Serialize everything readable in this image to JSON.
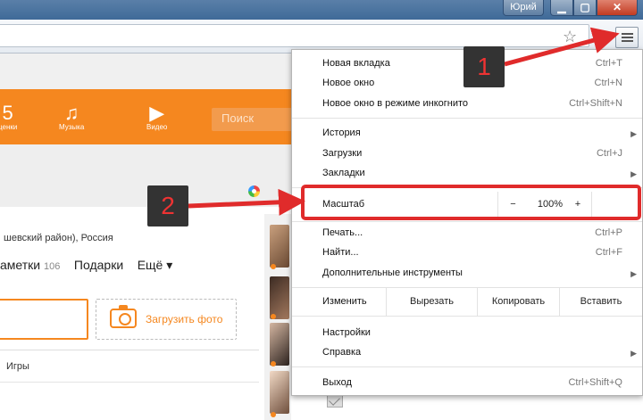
{
  "window": {
    "user_label": "Юрий",
    "minimize_glyph": "▁",
    "maximize_glyph": "▢",
    "close_glyph": "✕"
  },
  "toolbar": {
    "bookmark_icon": "☆",
    "menu_icon": "hamburger-icon"
  },
  "site": {
    "nav": [
      {
        "label": "ценки",
        "icon": "ratings-icon",
        "glyph": "5"
      },
      {
        "label": "Музыка",
        "icon": "music-icon",
        "glyph": "♫"
      },
      {
        "label": "Видео",
        "icon": "video-icon",
        "glyph": "▶"
      }
    ],
    "search_placeholder": "Поиск",
    "location": "шевский район), Россия",
    "profile_nav": {
      "notes_label": "аметки",
      "notes_count": "106",
      "gifts_label": "Подарки",
      "more_label": "Ещё ▾"
    },
    "upload_photo_label": "Загрузить фото",
    "games_label": "Игры",
    "accent_color": "#f5871f"
  },
  "menu": {
    "new_tab": {
      "label": "Новая вкладка",
      "shortcut": "Ctrl+T"
    },
    "new_window": {
      "label": "Новое окно",
      "shortcut": "Ctrl+N"
    },
    "incognito": {
      "label": "Новое окно в режиме инкогнито",
      "shortcut": "Ctrl+Shift+N"
    },
    "history": {
      "label": "История"
    },
    "downloads": {
      "label": "Загрузки",
      "shortcut": "Ctrl+J"
    },
    "bookmarks": {
      "label": "Закладки"
    },
    "zoom": {
      "label": "Масштаб",
      "minus": "−",
      "value": "100%",
      "plus": "+"
    },
    "print": {
      "label": "Печать...",
      "shortcut": "Ctrl+P"
    },
    "find": {
      "label": "Найти...",
      "shortcut": "Ctrl+F"
    },
    "more_tools": {
      "label": "Дополнительные инструменты"
    },
    "edit": {
      "label": "Изменить",
      "cut": "Вырезать",
      "copy": "Копировать",
      "paste": "Вставить"
    },
    "settings": {
      "label": "Настройки"
    },
    "help": {
      "label": "Справка"
    },
    "exit": {
      "label": "Выход",
      "shortcut": "Ctrl+Shift+Q"
    },
    "submenu_arrow": "▶"
  },
  "annotations": {
    "callout_1": "1",
    "callout_2": "2",
    "highlight_color": "#e02b2b"
  }
}
